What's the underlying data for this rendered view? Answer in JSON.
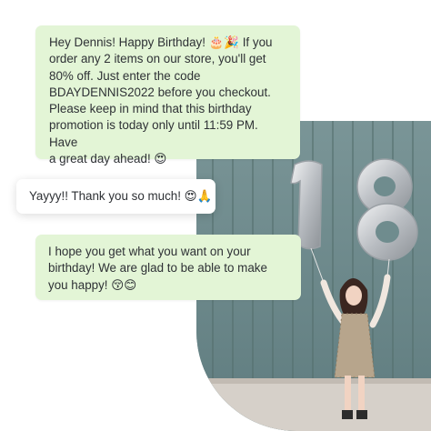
{
  "chat": {
    "messages": [
      {
        "text": "Hey Dennis! Happy Birthday! 🎂🎉 If you\norder any 2 items on our store, you'll get\n80% off. Just enter the code\nBDAYDENNIS2022 before you checkout.\nPlease keep in mind that this birthday\npromotion is today only until 11:59 PM. Have\na great day ahead! 😍",
        "sender": "business"
      },
      {
        "text": "Yayyy!! Thank you so much! 😍🙏",
        "sender": "customer"
      },
      {
        "text": "I hope you get what you want on your\nbirthday! We are glad to be able to make\nyou happy! 😚😊",
        "sender": "business"
      }
    ]
  },
  "photo": {
    "subject": "woman holding number 18 balloons",
    "balloon_text": "18"
  },
  "colors": {
    "business_bubble": "#e3f5d6",
    "customer_bubble": "#ffffff",
    "wall": "#6f8c8e",
    "balloon": "#c9ccd0"
  }
}
